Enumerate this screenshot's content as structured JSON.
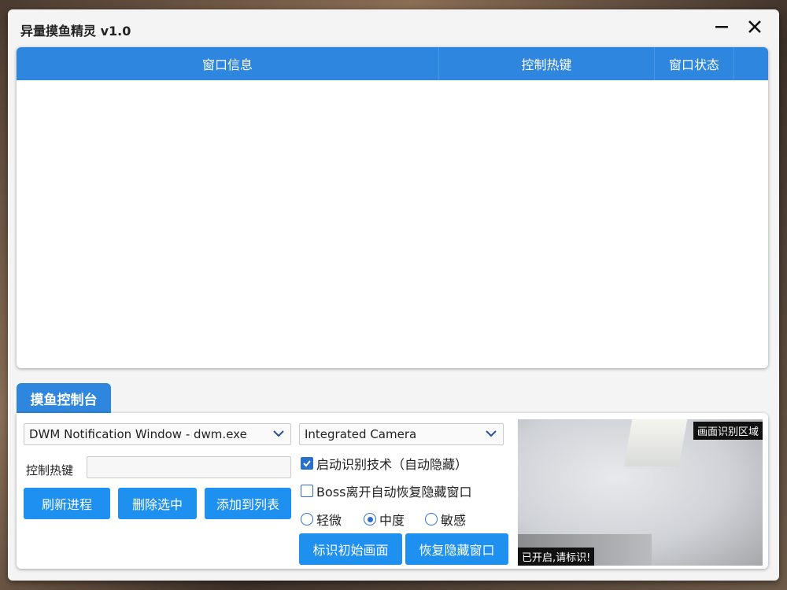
{
  "window": {
    "title": "异量摸鱼精灵 v1.0"
  },
  "table": {
    "columns": [
      "窗口信息",
      "控制热键",
      "窗口状态"
    ]
  },
  "tab": {
    "label": "摸鱼控制台"
  },
  "controls": {
    "process_select": "DWM Notification Window - dwm.exe",
    "camera_select": "Integrated Camera",
    "hotkey_label": "控制热键",
    "hotkey_value": "",
    "refresh_button": "刷新进程",
    "delete_button": "删除选中",
    "add_button": "添加到列表",
    "recognition_check": "启动识别技术（自动隐藏）",
    "boss_check": "Boss离开自动恢复隐藏窗口",
    "sensitivity": [
      "轻微",
      "中度",
      "敏感"
    ],
    "mark_button": "标识初始画面",
    "restore_button": "恢复隐藏窗口"
  },
  "camera": {
    "region_label": "画面识别区域",
    "status_label": "已开启,请标识!"
  }
}
